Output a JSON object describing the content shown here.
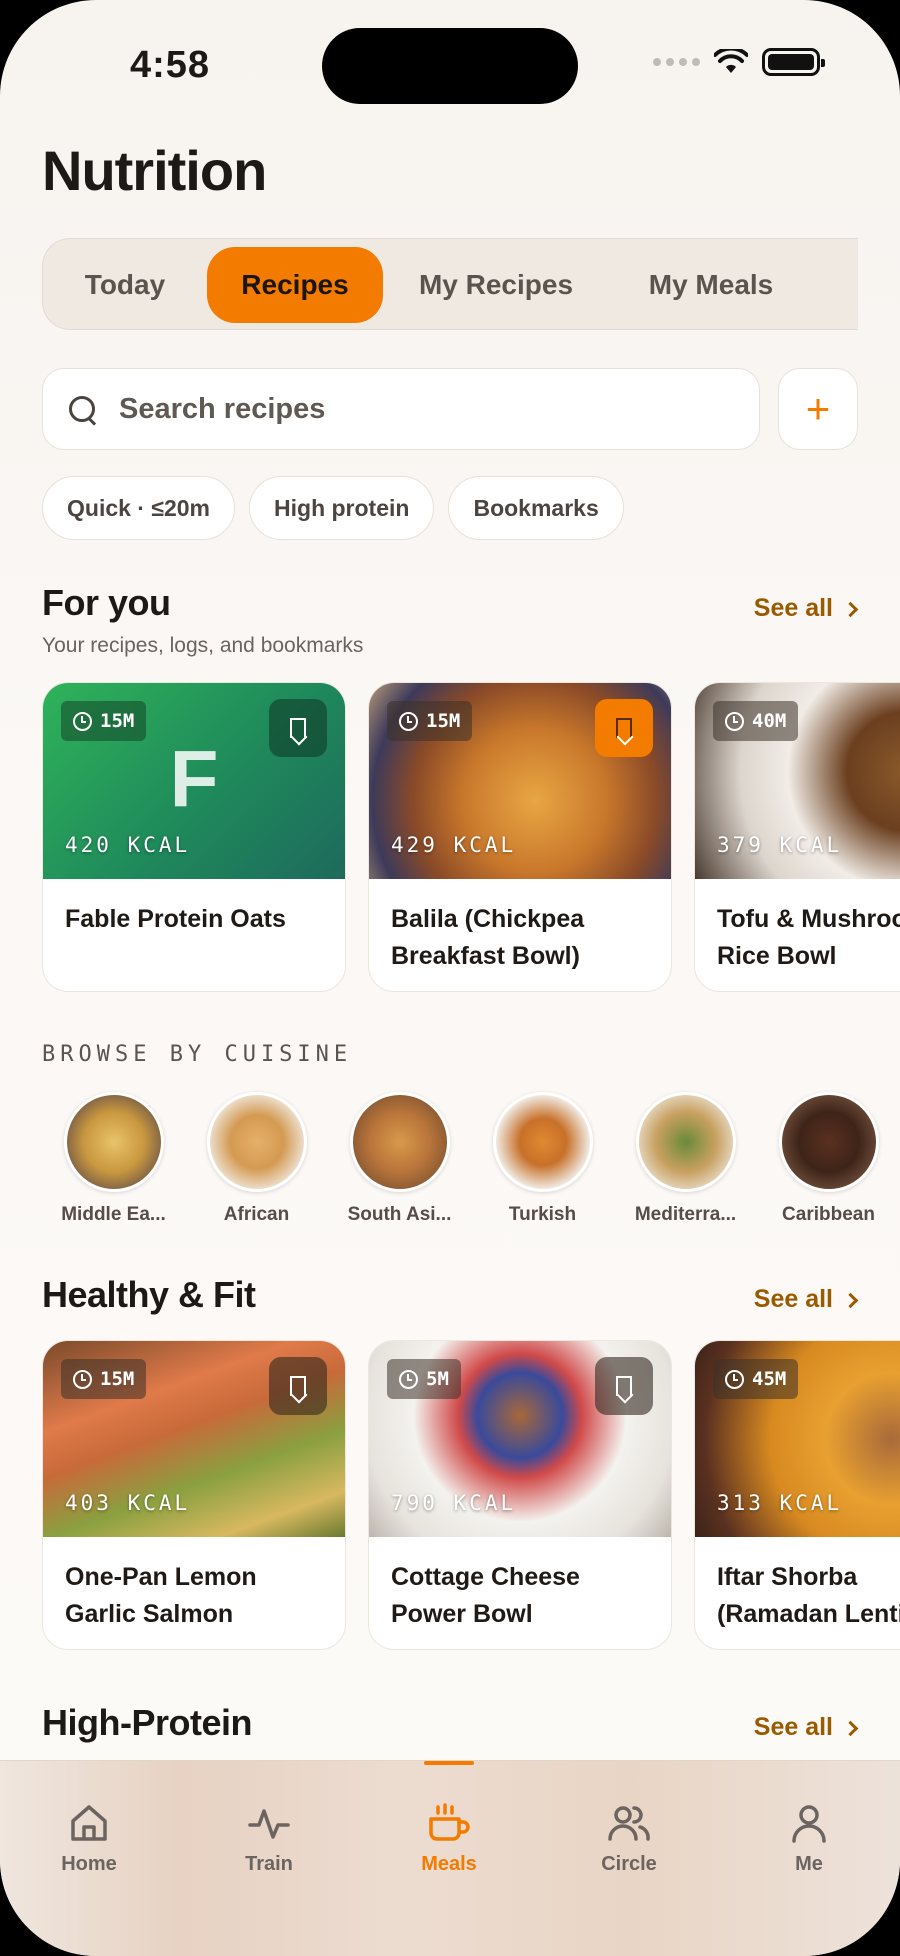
{
  "status_bar": {
    "time": "4:58"
  },
  "page_title": "Nutrition",
  "tabs": [
    {
      "label": "Today",
      "active": false
    },
    {
      "label": "Recipes",
      "active": true
    },
    {
      "label": "My Recipes",
      "active": false
    },
    {
      "label": "My Meals",
      "active": false
    }
  ],
  "search": {
    "placeholder": "Search recipes",
    "value": ""
  },
  "add_button": "+",
  "filters": [
    "Quick · ≤20m",
    "High protein",
    "Bookmarks"
  ],
  "for_you": {
    "title": "For you",
    "subtitle": "Your recipes, logs, and bookmarks",
    "see_all": "See all",
    "cards": [
      {
        "name": "Fable Protein Oats",
        "time": "15M",
        "kcal": "420 KCAL",
        "initial": "F",
        "bookmarked": false
      },
      {
        "name": "Balila (Chickpea Breakfast Bowl)",
        "time": "15M",
        "kcal": "429 KCAL",
        "bookmarked": true
      },
      {
        "name": "Tofu & Mushroom Rice Bowl",
        "time": "40M",
        "kcal": "379 KCAL",
        "bookmarked": false
      }
    ]
  },
  "browse_label": "BROWSE BY CUISINE",
  "cuisines": [
    "Middle Ea...",
    "African",
    "South Asi...",
    "Turkish",
    "Mediterra...",
    "Caribbean"
  ],
  "healthy_fit": {
    "title": "Healthy & Fit",
    "see_all": "See all",
    "cards": [
      {
        "name": "One-Pan Lemon Garlic Salmon",
        "time": "15M",
        "kcal": "403 KCAL",
        "bookmarked": false
      },
      {
        "name": "Cottage Cheese Power Bowl",
        "time": "5M",
        "kcal": "790 KCAL",
        "bookmarked": false
      },
      {
        "name": "Iftar Shorba (Ramadan Lentil",
        "time": "45M",
        "kcal": "313 KCAL",
        "bookmarked": false
      }
    ]
  },
  "high_protein": {
    "title": "High-Protein",
    "see_all": "See all"
  },
  "tabbar": [
    {
      "label": "Home",
      "icon": "home-icon"
    },
    {
      "label": "Train",
      "icon": "activity-icon"
    },
    {
      "label": "Meals",
      "icon": "cup-icon",
      "active": true
    },
    {
      "label": "Circle",
      "icon": "users-icon"
    },
    {
      "label": "Me",
      "icon": "user-icon"
    }
  ],
  "colors": {
    "accent": "#f27b00",
    "see_all": "#9a5a00",
    "background": "#f8f4f0"
  }
}
